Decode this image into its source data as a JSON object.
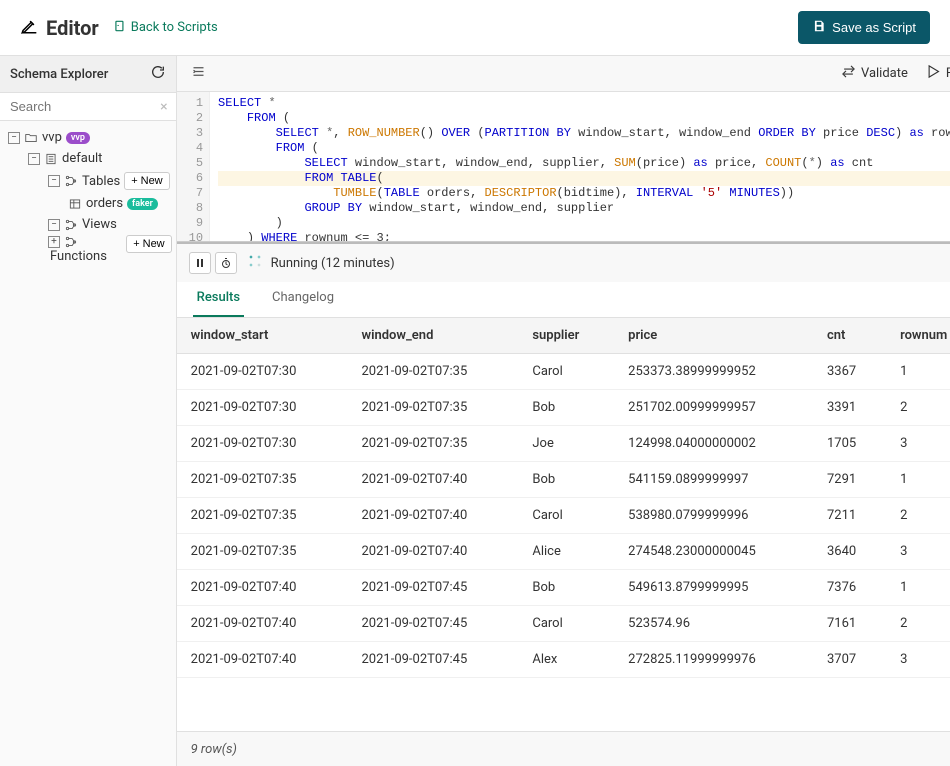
{
  "header": {
    "title": "Editor",
    "back_link": "Back to Scripts",
    "save_label": "Save as Script"
  },
  "sidebar": {
    "title": "Schema Explorer",
    "search_placeholder": "Search",
    "tree": {
      "root": "vvp",
      "root_badge": "vvp",
      "default": "default",
      "tables": "Tables",
      "orders": "orders",
      "orders_badge": "faker",
      "views": "Views",
      "functions": "Functions",
      "new_label": "New"
    }
  },
  "toolbar": {
    "validate": "Validate",
    "run": "Run"
  },
  "code": {
    "lines": [
      "SELECT *",
      "    FROM (",
      "        SELECT *, ROW_NUMBER() OVER (PARTITION BY window_start, window_end ORDER BY price DESC) as rownum",
      "        FROM (",
      "            SELECT window_start, window_end, supplier, SUM(price) as price, COUNT(*) as cnt",
      "            FROM TABLE(",
      "                TUMBLE(TABLE orders, DESCRIPTOR(bidtime), INTERVAL '5' MINUTES))",
      "            GROUP BY window_start, window_end, supplier",
      "        )",
      "    ) WHERE rownum <= 3;"
    ]
  },
  "results": {
    "status": "Running (12 minutes)",
    "tabs": {
      "results": "Results",
      "changelog": "Changelog"
    },
    "columns": [
      "window_start",
      "window_end",
      "supplier",
      "price",
      "cnt",
      "rownum"
    ],
    "rows": [
      [
        "2021-09-02T07:30",
        "2021-09-02T07:35",
        "Carol",
        "253373.38999999952",
        "3367",
        "1"
      ],
      [
        "2021-09-02T07:30",
        "2021-09-02T07:35",
        "Bob",
        "251702.00999999957",
        "3391",
        "2"
      ],
      [
        "2021-09-02T07:30",
        "2021-09-02T07:35",
        "Joe",
        "124998.04000000002",
        "1705",
        "3"
      ],
      [
        "2021-09-02T07:35",
        "2021-09-02T07:40",
        "Bob",
        "541159.0899999997",
        "7291",
        "1"
      ],
      [
        "2021-09-02T07:35",
        "2021-09-02T07:40",
        "Carol",
        "538980.0799999996",
        "7211",
        "2"
      ],
      [
        "2021-09-02T07:35",
        "2021-09-02T07:40",
        "Alice",
        "274548.23000000045",
        "3640",
        "3"
      ],
      [
        "2021-09-02T07:40",
        "2021-09-02T07:45",
        "Bob",
        "549613.8799999995",
        "7376",
        "1"
      ],
      [
        "2021-09-02T07:40",
        "2021-09-02T07:45",
        "Carol",
        "523574.96",
        "7161",
        "2"
      ],
      [
        "2021-09-02T07:40",
        "2021-09-02T07:45",
        "Alex",
        "272825.11999999976",
        "3707",
        "3"
      ]
    ],
    "footer": "9 row(s)"
  }
}
